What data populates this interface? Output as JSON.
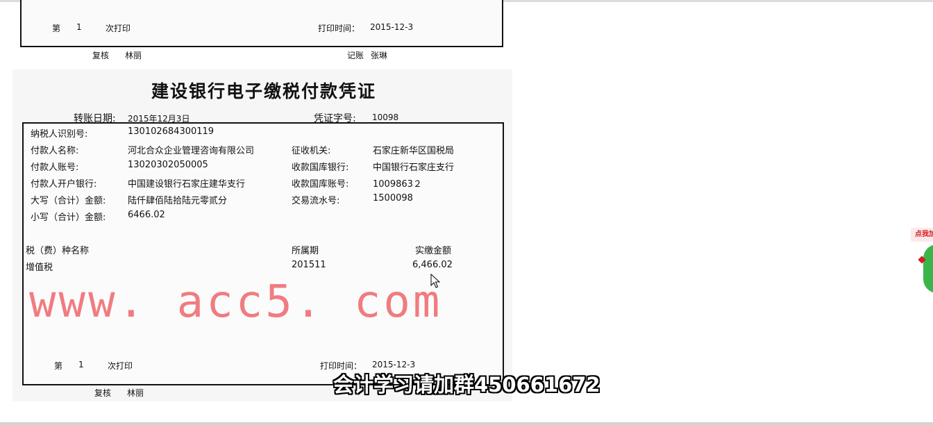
{
  "previous_voucher": {
    "print_count_prefix": "第",
    "print_count": "1",
    "print_count_suffix": "次打印",
    "print_time_label": "打印时间：",
    "print_time": "2015-12-3",
    "reviewer_label": "复核",
    "reviewer": "林丽",
    "bookkeeper_label": "记账",
    "bookkeeper": "张琳"
  },
  "voucher": {
    "title": "建设银行电子缴税付款凭证",
    "transfer_date_label": "转账日期:",
    "transfer_date": "2015年12月3日",
    "voucher_no_label": "凭证字号:",
    "voucher_no": "10098",
    "taxpayer_id_label": "纳税人识别号:",
    "taxpayer_id": "130102684300119",
    "payer_name_label": "付款人名称:",
    "payer_name": "河北合众企业管理咨询有限公司",
    "collector_label": "征收机关:",
    "collector": "石家庄新华区国税局",
    "payer_account_label": "付款人账号:",
    "payer_account": "13020302050005",
    "treasury_bank_label": "收款国库银行:",
    "treasury_bank": "中国银行石家庄支行",
    "payer_bank_label": "付款人开户银行:",
    "payer_bank": "中国建设银行石家庄建华支行",
    "treasury_account_label": "收款国库账号:",
    "treasury_account": "1009863２",
    "amount_upper_label": "大写（合计）金额:",
    "amount_upper": "陆仟肆佰陆拾陆元零贰分",
    "serial_label": "交易流水号:",
    "serial": "1500098",
    "amount_lower_label": "小写（合计）金额:",
    "amount_lower": "6466.02",
    "table_headers": [
      "税（费）种名称",
      "所属期",
      "实缴金额"
    ],
    "table_rows": [
      {
        "tax_type": "增值税",
        "period": "201511",
        "amount": "6,466.02"
      }
    ],
    "print_count_prefix": "第",
    "print_count": "1",
    "print_count_suffix": "次打印",
    "print_time_label": "打印时间：",
    "print_time": "2015-12-3",
    "reviewer_label": "复核",
    "reviewer": "林丽"
  },
  "watermark": "www. acc5. com",
  "subtitle": "会计学习请加群450661672",
  "side_widget": {
    "label": "点我加"
  },
  "colors": {
    "watermark": "#f07c80",
    "widget": "#3bb54a",
    "widget_tag": "#d42020"
  }
}
